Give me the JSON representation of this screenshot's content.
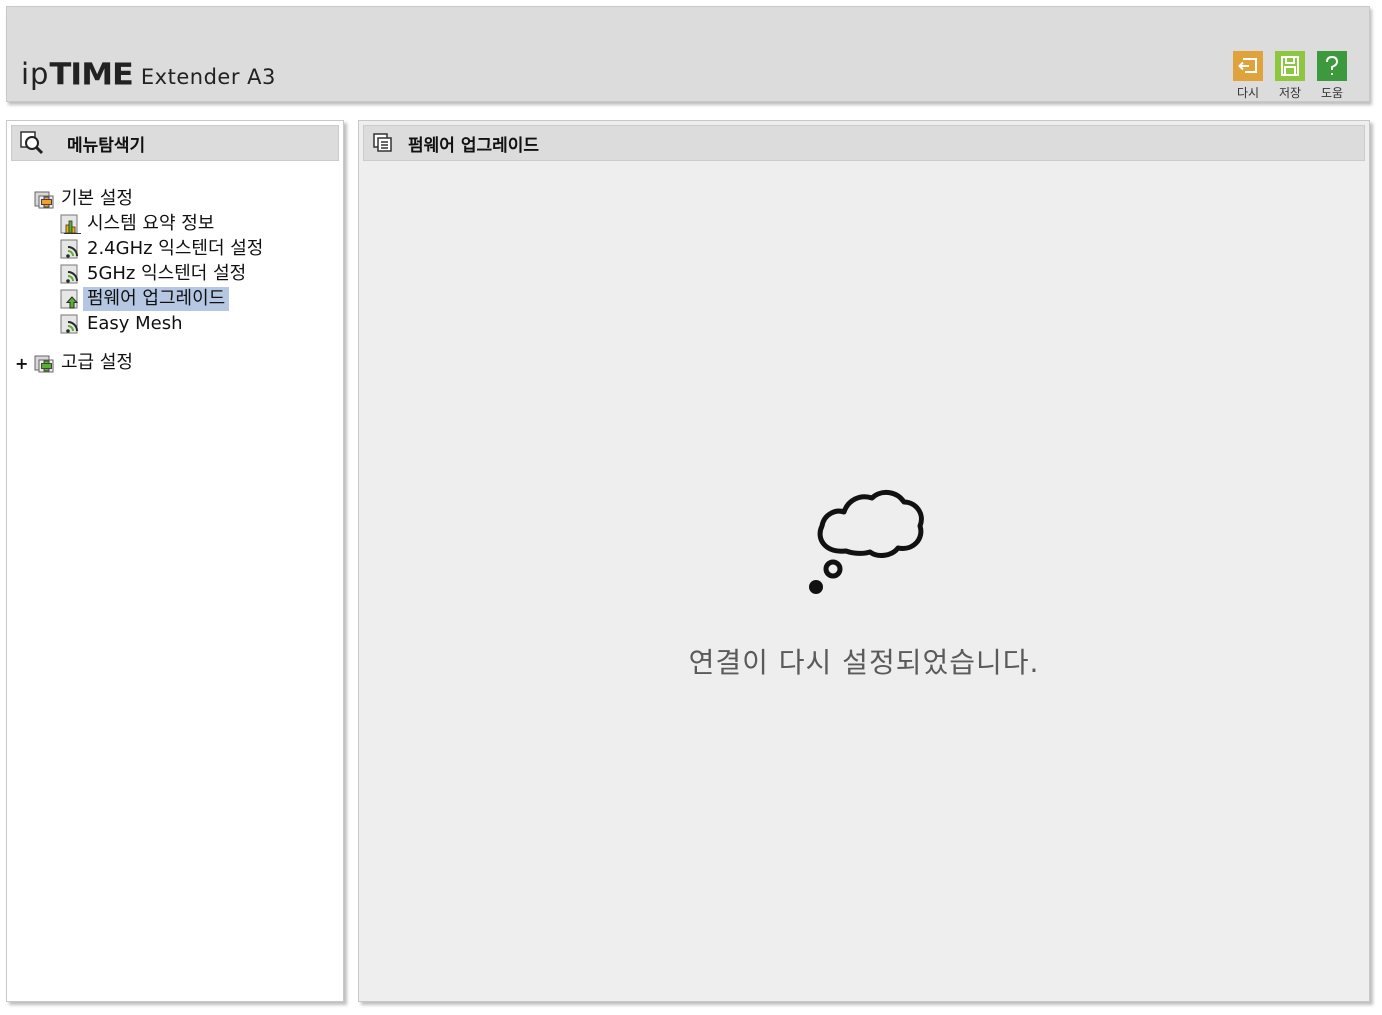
{
  "header": {
    "logo": {
      "ip": "ip",
      "time": "TIME",
      "model": "Extender A3"
    },
    "buttons": [
      {
        "id": "reload",
        "label": "다시",
        "color": "#e0a23b",
        "icon": "undo-icon"
      },
      {
        "id": "save",
        "label": "저장",
        "color": "#8dc63f",
        "icon": "save-icon"
      },
      {
        "id": "help",
        "label": "도움",
        "color": "#3c9a3c",
        "icon": "help-icon"
      }
    ]
  },
  "sidebar": {
    "title": "메뉴탐색기",
    "basic": {
      "label": "기본 설정",
      "items": [
        {
          "label": "시스템 요약 정보",
          "icon": "chart-icon"
        },
        {
          "label": "2.4GHz 익스텐더 설정",
          "icon": "wireless-icon"
        },
        {
          "label": "5GHz 익스텐더 설정",
          "icon": "wireless-icon"
        },
        {
          "label": "펌웨어 업그레이드",
          "icon": "upgrade-icon",
          "selected": true
        },
        {
          "label": "Easy Mesh",
          "icon": "wireless-icon"
        }
      ]
    },
    "advanced": {
      "label": "고급 설정",
      "expander": "+"
    }
  },
  "main": {
    "title": "펌웨어 업그레이드",
    "message": "연결이 다시 설정되었습니다.",
    "icon": "thought-bubble-icon"
  }
}
